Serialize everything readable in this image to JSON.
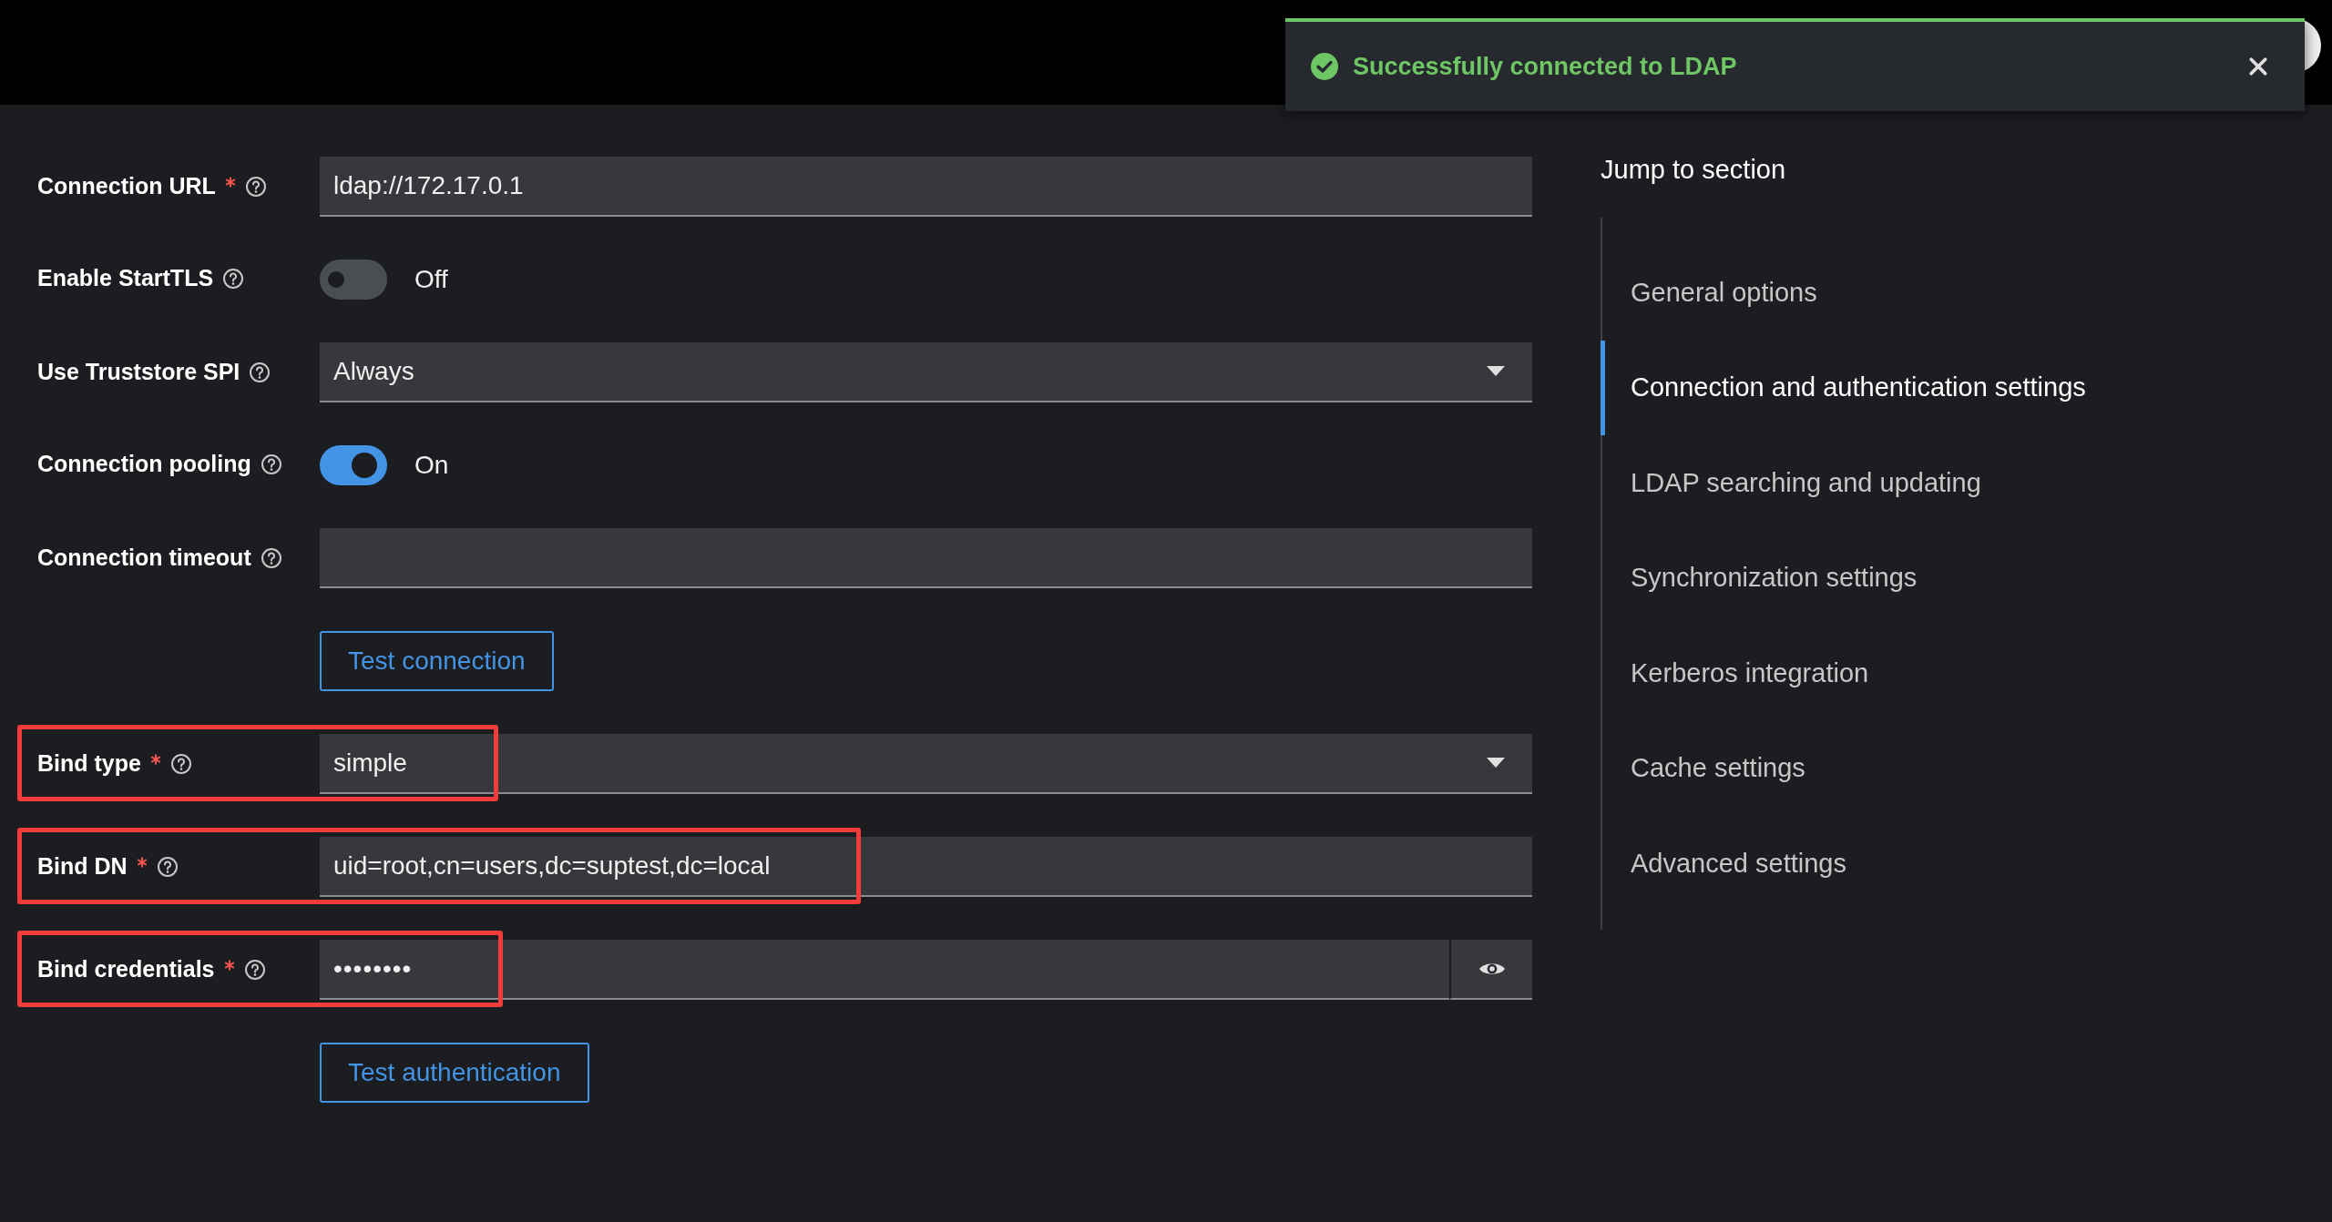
{
  "toast": {
    "message": "Successfully connected to LDAP"
  },
  "fields": [
    {
      "kind": "text",
      "label": "Connection URL",
      "required": true,
      "highlighted": false,
      "value": "ldap://172.17.0.1"
    },
    {
      "kind": "switch",
      "label": "Enable StartTLS",
      "required": false,
      "highlighted": false,
      "on": false,
      "state_label": "Off"
    },
    {
      "kind": "select",
      "label": "Use Truststore SPI",
      "required": false,
      "highlighted": false,
      "value": "Always"
    },
    {
      "kind": "switch",
      "label": "Connection pooling",
      "required": false,
      "highlighted": false,
      "on": true,
      "state_label": "On"
    },
    {
      "kind": "text",
      "label": "Connection timeout",
      "required": false,
      "highlighted": false
    },
    {
      "kind": "button",
      "text": "Test connection"
    },
    {
      "kind": "select",
      "label": "Bind type",
      "required": true,
      "highlighted": true,
      "value": "simple"
    },
    {
      "kind": "text",
      "label": "Bind DN",
      "required": true,
      "highlighted": true,
      "value": "uid=root,cn=users,dc=suptest,dc=local"
    },
    {
      "kind": "password",
      "label": "Bind credentials",
      "required": true,
      "highlighted": true,
      "value": "••••••••"
    },
    {
      "kind": "button",
      "text": "Test authentication"
    }
  ],
  "jump_to_section": {
    "title": "Jump to section",
    "items": [
      {
        "label": "General options",
        "selected": false
      },
      {
        "label": "Connection and authentication settings",
        "selected": true
      },
      {
        "label": "LDAP searching and updating",
        "selected": false
      },
      {
        "label": "Synchronization settings",
        "selected": false
      },
      {
        "label": "Kerberos integration",
        "selected": false
      },
      {
        "label": "Cache settings",
        "selected": false
      },
      {
        "label": "Advanced settings",
        "selected": false
      }
    ]
  }
}
